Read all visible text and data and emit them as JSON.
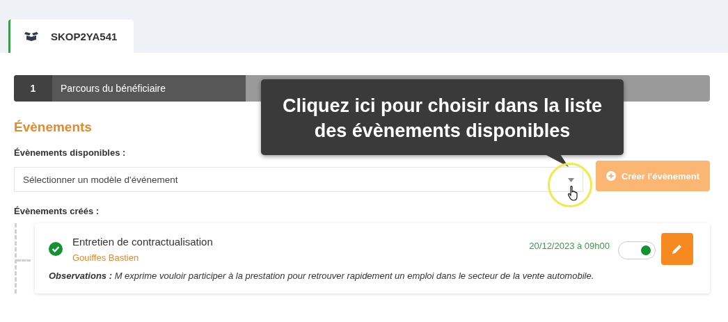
{
  "tab": {
    "label": "SKOP2YA541",
    "selected": true
  },
  "stepper": {
    "steps": [
      {
        "number": "1",
        "label": "Parcours du bénéficiaire",
        "selected": true
      }
    ]
  },
  "section_title": "Évènements",
  "available": {
    "label": "Évènements disponibles :",
    "placeholder": "Sélectionner un modèle d'événement",
    "create_button": "Créer l'évènement",
    "create_disabled": true
  },
  "created": {
    "label": "Évènements créés :",
    "events": [
      {
        "title": "Entretien de contractualisation",
        "person": "Gouiffes Bastien",
        "date": "20/12/2023 à 09h00",
        "done": true,
        "on": true,
        "observations": "**Observations :** M exprime vouloir participer à la prestation pour retrouver rapidement un emploi dans le secteur de la vente automobile."
      }
    ]
  },
  "tooltip": {
    "text": "Cliquez ici pour choisir dans la liste des évènements disponibles"
  }
}
